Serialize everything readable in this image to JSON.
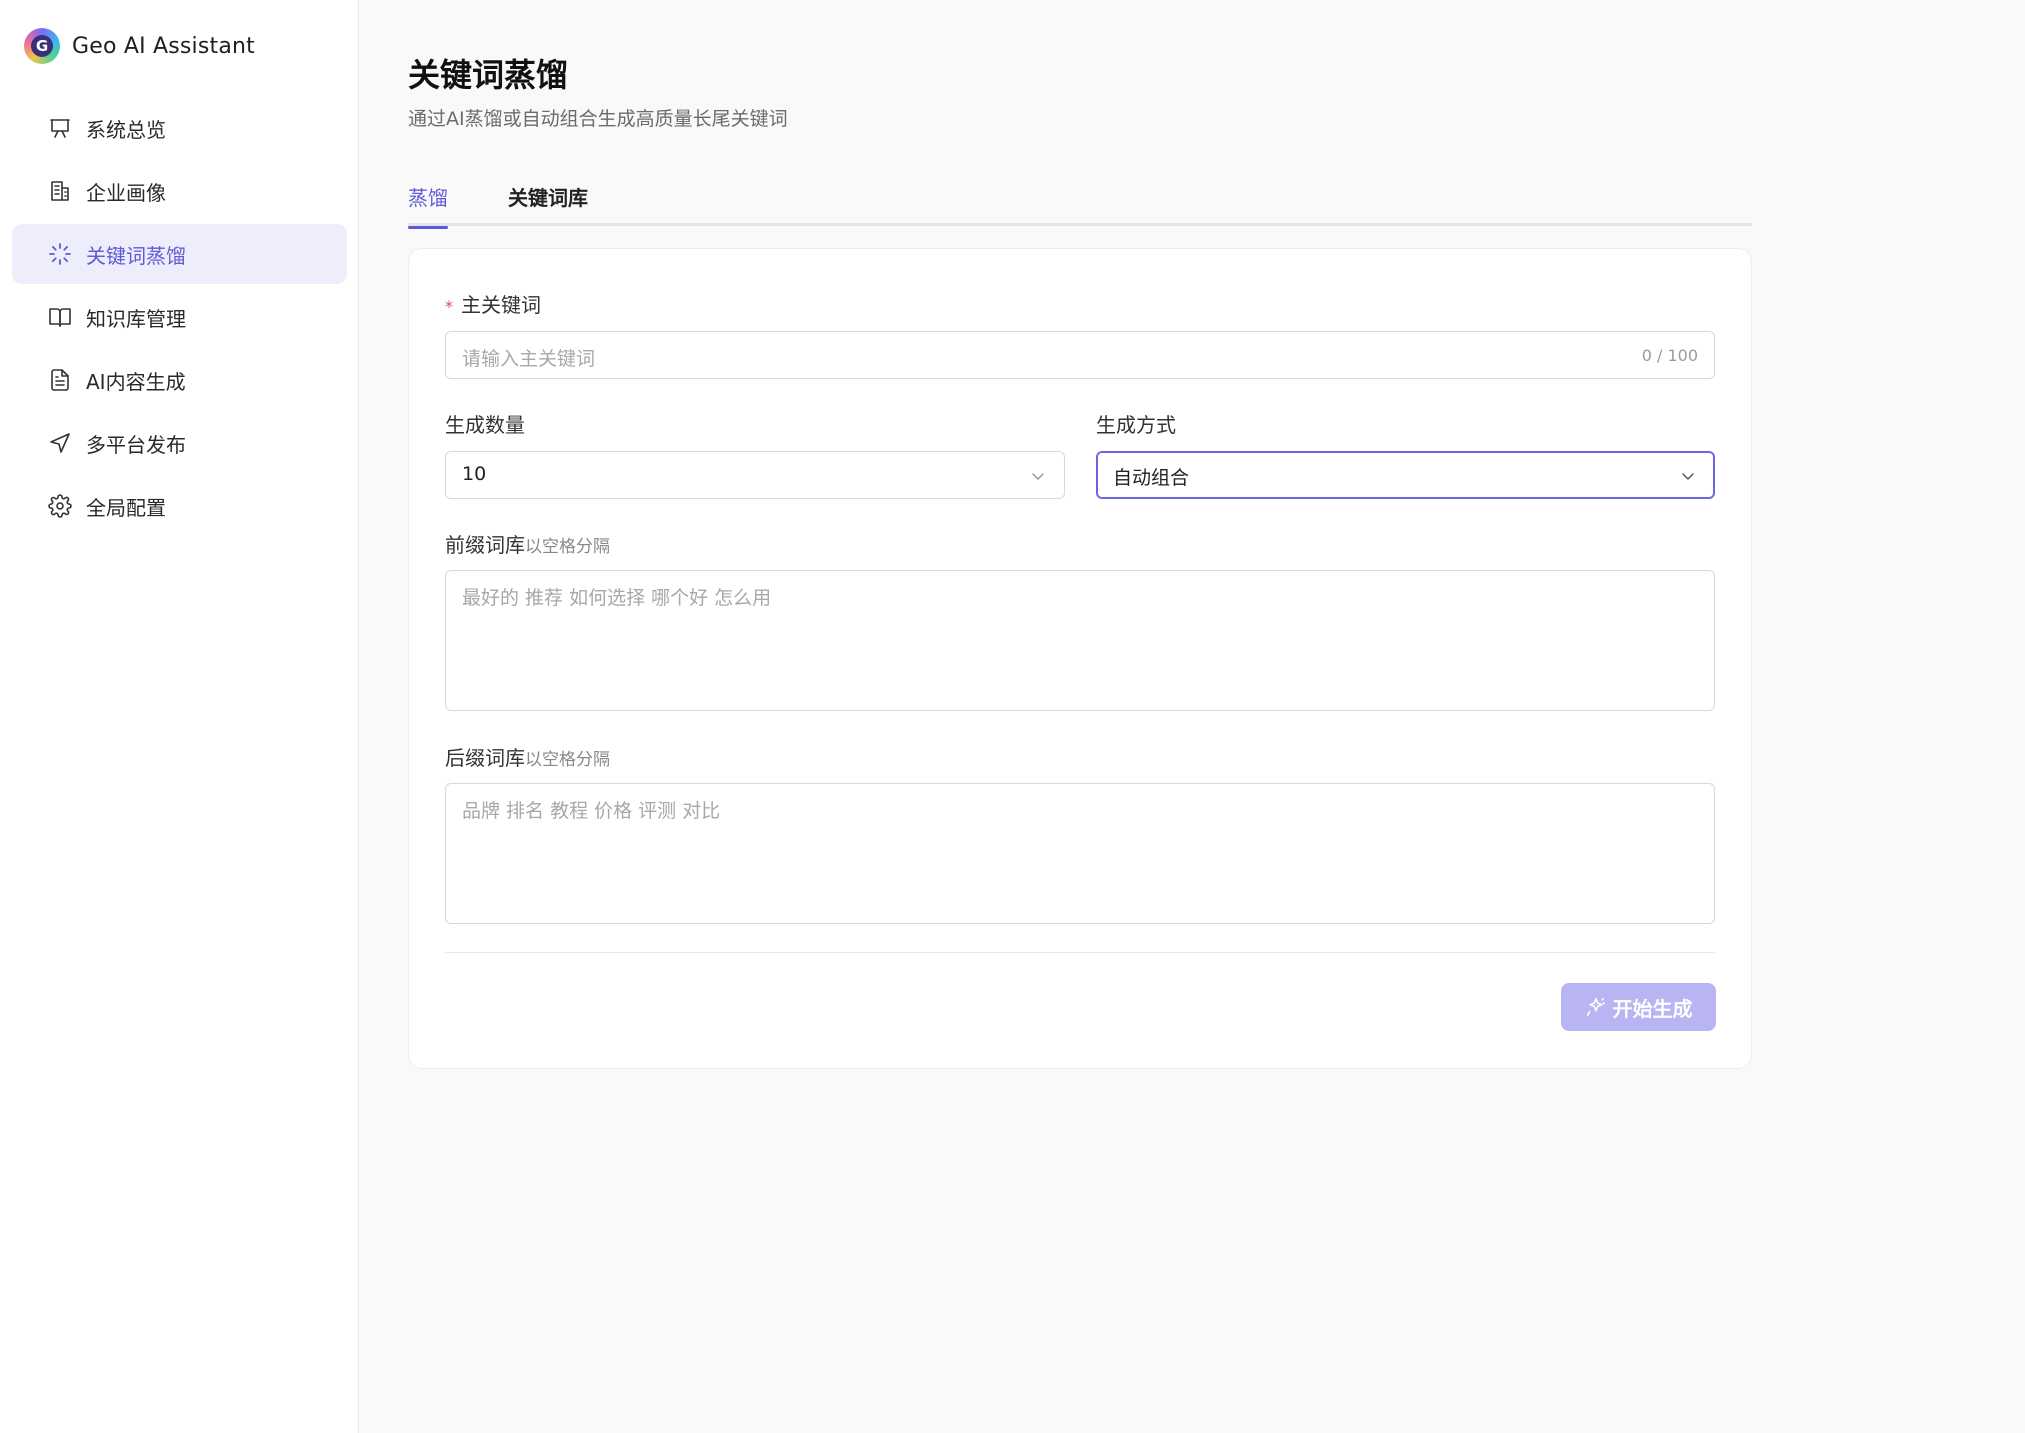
{
  "app": {
    "name": "Geo AI Assistant"
  },
  "sidebar": {
    "items": [
      {
        "label": "系统总览",
        "icon": "presentation-icon"
      },
      {
        "label": "企业画像",
        "icon": "building-icon"
      },
      {
        "label": "关键词蒸馏",
        "icon": "loader-icon",
        "active": true
      },
      {
        "label": "知识库管理",
        "icon": "book-icon"
      },
      {
        "label": "AI内容生成",
        "icon": "document-icon"
      },
      {
        "label": "多平台发布",
        "icon": "send-icon"
      },
      {
        "label": "全局配置",
        "icon": "gear-icon"
      }
    ]
  },
  "page": {
    "title": "关键词蒸馏",
    "subtitle": "通过AI蒸馏或自动组合生成高质量长尾关键词"
  },
  "tabs": [
    {
      "label": "蒸馏",
      "active": true
    },
    {
      "label": "关键词库",
      "active": false
    }
  ],
  "form": {
    "main_keyword": {
      "required_mark": "*",
      "label": "主关键词",
      "placeholder": "请输入主关键词",
      "counter": "0 / 100"
    },
    "count": {
      "label": "生成数量",
      "value": "10"
    },
    "method": {
      "label": "生成方式",
      "value": "自动组合"
    },
    "prefix": {
      "label": "前缀词库",
      "hint": "以空格分隔",
      "placeholder": "最好的 推荐 如何选择 哪个好 怎么用"
    },
    "suffix": {
      "label": "后缀词库",
      "hint": "以空格分隔",
      "placeholder": "品牌 排名 教程 价格 评测 对比"
    },
    "submit_label": "开始生成"
  },
  "colors": {
    "accent": "#5f5bd6",
    "active_nav_bg": "#eeedfc",
    "button_disabled": "#b8b5f2",
    "required": "#e5484d"
  }
}
